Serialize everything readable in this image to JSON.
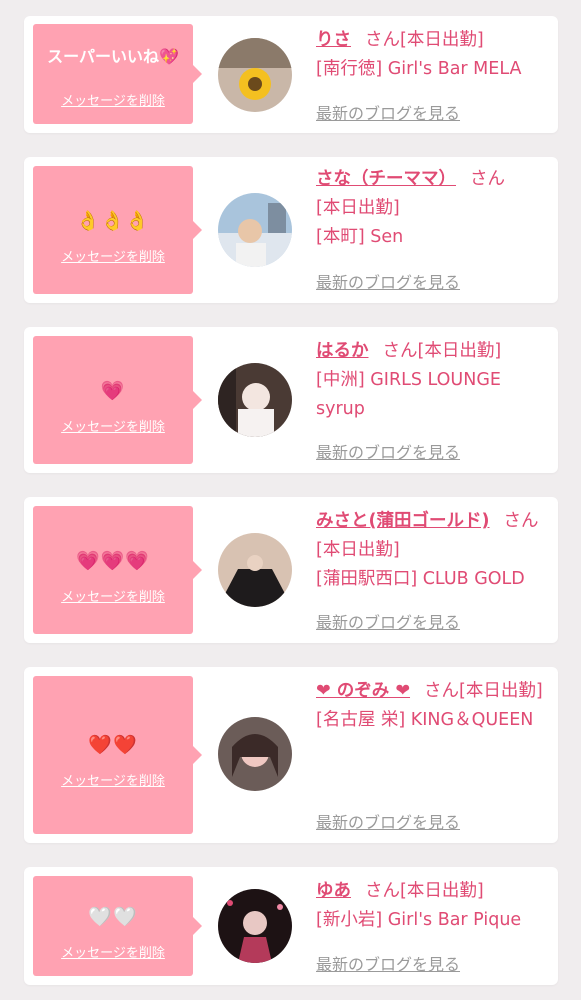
{
  "items": [
    {
      "reaction": "スーパーいいね💖",
      "delete_label": "メッセージを削除",
      "name": "りさ",
      "san": "さん",
      "status": "[本日出勤]",
      "shop": "[南行徳] Girl's Bar MELA",
      "blog_label": "最新のブログを見る"
    },
    {
      "reaction": "👌👌👌",
      "delete_label": "メッセージを削除",
      "name": "さな（チーママ）",
      "san": "さん",
      "status": "[本日出勤]",
      "shop": "[本町] Sen",
      "blog_label": "最新のブログを見る"
    },
    {
      "reaction": "💗",
      "delete_label": "メッセージを削除",
      "name": "はるか",
      "san": "さん",
      "status": "[本日出勤]",
      "shop": "[中洲] GIRLS LOUNGE syrup",
      "blog_label": "最新のブログを見る"
    },
    {
      "reaction": "💗💗💗",
      "delete_label": "メッセージを削除",
      "name": "みさと(蒲田ゴールド)",
      "san": "さん",
      "status": "[本日出勤]",
      "shop": "[蒲田駅西口] CLUB GOLD",
      "blog_label": "最新のブログを見る"
    },
    {
      "reaction": "❤️❤️",
      "delete_label": "メッセージを削除",
      "name": "❤︎ のぞみ ❤︎",
      "san": "さん",
      "status": "[本日出勤]",
      "shop": "[名古屋 栄] KING＆QUEEN",
      "blog_label": "最新のブログを見る"
    },
    {
      "reaction": "🤍🤍",
      "delete_label": "メッセージを削除",
      "name": "ゆあ",
      "san": "さん",
      "status": "[本日出勤]",
      "shop": "[新小岩] Girl's Bar Pique",
      "blog_label": "最新のブログを見る"
    }
  ],
  "colors": {
    "page_bg": "#f0edee",
    "card_bg": "#ffffff",
    "bubble": "#ffa2b2",
    "accent": "#e04b74",
    "link_gray": "#9a9a9a"
  }
}
